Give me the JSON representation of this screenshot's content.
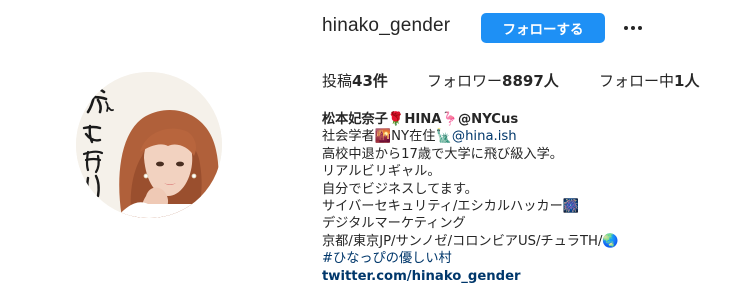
{
  "profile": {
    "username": "hinako_gender",
    "follow_label": "フォローする",
    "more_icon": "ellipsis-icon"
  },
  "stats": {
    "posts_label": "投稿",
    "posts_count": "43件",
    "followers_label": "フォロワー",
    "followers_count": "8897人",
    "following_label": "フォロー中",
    "following_count": "1人"
  },
  "avatar": {
    "calligraphy": "愛は、思い",
    "alt": "profile photo"
  },
  "bio": {
    "name": "松本妃奈子🌹HINA🦩@NYCus",
    "line2_prefix": "社会学者🌇NY在住🗽",
    "line2_mention": "@hina.ish",
    "line3": "高校中退から17歳で大学に飛び級入学。",
    "line4": "リアルビリギャル。",
    "line5": "自分でビジネスしてます。",
    "line6": "サイバーセキュリティ/エシカルハッカー🎆",
    "line7": "デジタルマーケティング",
    "line8": "京都/東京JP/サンノゼ/コロンビアUS/チュラTH/🌏",
    "hashtag": "#ひなっぴの優しい村",
    "link": "twitter.com/hinako_gender"
  }
}
